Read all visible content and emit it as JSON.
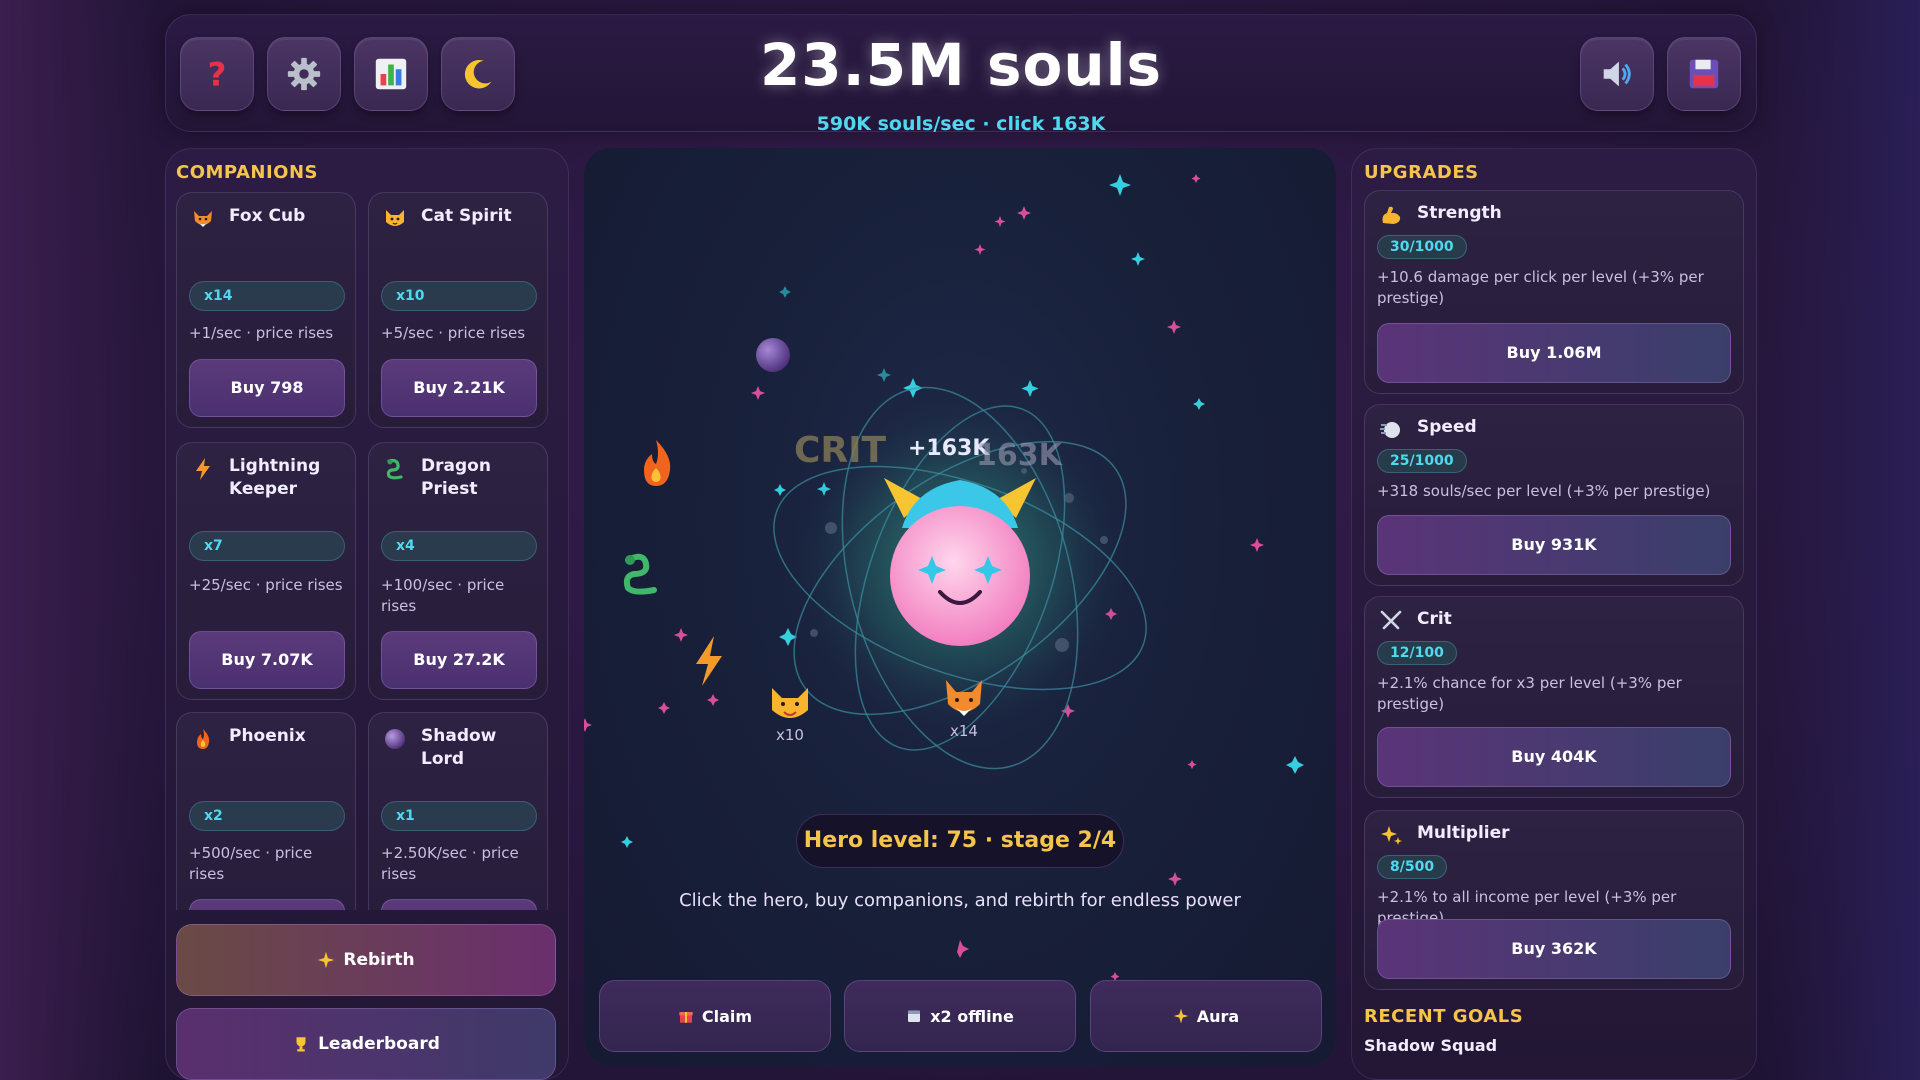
{
  "header": {
    "souls": "23.5M souls",
    "rate": "590K souls/sec · click 163K",
    "buttons": [
      "help-icon",
      "settings-icon",
      "stats-icon",
      "moon-icon",
      "sound-icon",
      "save-icon"
    ]
  },
  "companions": {
    "title": "COMPANIONS",
    "cards": [
      {
        "name": "Fox Cub",
        "count": "x14",
        "desc": "+1/sec · price rises",
        "buy": "Buy 798",
        "icon": "fox-icon"
      },
      {
        "name": "Cat Spirit",
        "count": "x10",
        "desc": "+5/sec · price rises",
        "buy": "Buy 2.21K",
        "icon": "cat-icon"
      },
      {
        "name": "Lightning Keeper",
        "count": "x7",
        "desc": "+25/sec · price rises",
        "buy": "Buy 7.07K",
        "icon": "lightning-icon"
      },
      {
        "name": "Dragon Priest",
        "count": "x4",
        "desc": "+100/sec · price rises",
        "buy": "Buy 27.2K",
        "icon": "dragon-icon"
      },
      {
        "name": "Phoenix",
        "count": "x2",
        "desc": "+500/sec · price rises",
        "icon": "fire-icon"
      },
      {
        "name": "Shadow Lord",
        "count": "x1",
        "desc": "+2.50K/sec · price rises",
        "icon": "orb-icon"
      }
    ],
    "rebirth": "Rebirth",
    "leaderboard": "Leaderboard"
  },
  "stage": {
    "crit_text": "CRIT",
    "float_a": "+163K",
    "float_b": "163K",
    "companion_a": "x10",
    "companion_b": "x14",
    "level": "Hero level: 75 · stage 2/4",
    "hint": "Click the hero, buy companions, and rebirth for endless power",
    "claim": "Claim",
    "offline": "x2 offline",
    "aura": "Aura"
  },
  "upgrades": {
    "title": "UPGRADES",
    "items": [
      {
        "name": "Strength",
        "level": "30/1000",
        "desc": "+10.6 damage per click per level (+3% per prestige)",
        "buy": "Buy 1.06M",
        "icon": "muscle-icon"
      },
      {
        "name": "Speed",
        "level": "25/1000",
        "desc": "+318 souls/sec per level (+3% per prestige)",
        "buy": "Buy 931K",
        "icon": "speed-icon"
      },
      {
        "name": "Crit",
        "level": "12/100",
        "desc": "+2.1% chance for x3 per level (+3% per prestige)",
        "buy": "Buy 404K",
        "icon": "swords-icon"
      },
      {
        "name": "Multiplier",
        "level": "8/500",
        "desc": "+2.1% to all income per level (+3% per prestige)",
        "buy": "Buy 362K",
        "icon": "sparkle-icon"
      }
    ],
    "goals_title": "RECENT GOALS",
    "goal": "Shadow Squad"
  }
}
